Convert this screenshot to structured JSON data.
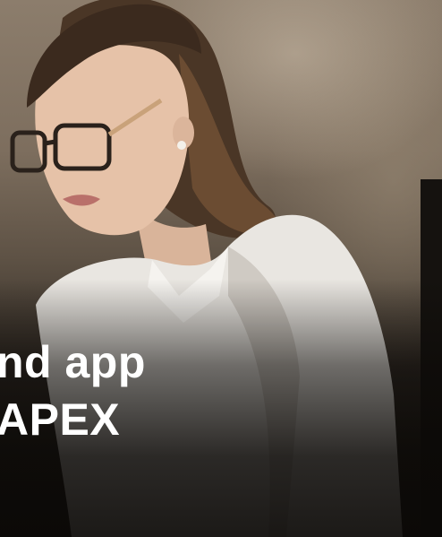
{
  "headline": {
    "line1": "nd app",
    "line2": " APEX"
  },
  "photo": {
    "subject": "woman-with-glasses-at-computer"
  }
}
